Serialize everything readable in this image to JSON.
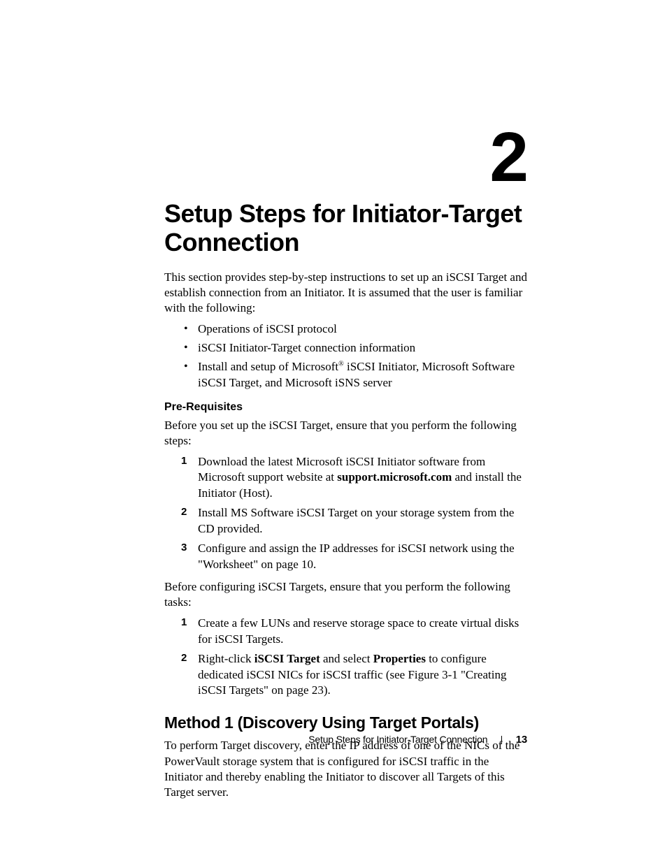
{
  "chapter_number": "2",
  "title": "Setup Steps for Initiator-Target Connection",
  "intro": "This section provides step-by-step instructions to set up an iSCSI Target and establish connection from an Initiator. It is assumed that the user is familiar with the following:",
  "bullets": {
    "b1": "Operations of iSCSI protocol",
    "b2": "iSCSI Initiator-Target connection information",
    "b3_pre": "Install and setup of Microsoft",
    "b3_sup": "®",
    "b3_post": " iSCSI Initiator, Microsoft Software iSCSI Target, and Microsoft iSNS server"
  },
  "prereq_heading": "Pre-Requisites",
  "prereq_intro": "Before you set up the iSCSI Target, ensure that you perform the following steps:",
  "steps1": {
    "s1_pre": "Download the latest Microsoft iSCSI Initiator software from Microsoft support website at ",
    "s1_bold": "support.microsoft.com",
    "s1_post": " and install the Initiator (Host).",
    "s2": "Install MS Software iSCSI Target on your storage system from the CD provided.",
    "s3": "Configure and assign the IP addresses for iSCSI network using the \"Worksheet\" on page 10."
  },
  "between": "Before configuring iSCSI Targets, ensure that you perform the following tasks:",
  "steps2": {
    "s1": "Create a few LUNs and reserve storage space to create virtual disks for iSCSI Targets.",
    "s2_pre": "Right-click ",
    "s2_b1": "iSCSI Target",
    "s2_mid": " and select ",
    "s2_b2": "Properties",
    "s2_post": " to configure dedicated iSCSI NICs for iSCSI traffic (see Figure 3-1 \"Creating iSCSI Targets\" on page 23)."
  },
  "method1_heading": "Method 1 (Discovery Using Target Portals)",
  "method1_body": "To perform Target discovery, enter the IP address of one of the NICs of the PowerVault storage system that is configured for iSCSI traffic in the Initiator and thereby enabling the Initiator to discover all Targets of this Target server.",
  "footer": {
    "label": "Setup Steps for Initiator-Target Connection",
    "page": "13"
  }
}
